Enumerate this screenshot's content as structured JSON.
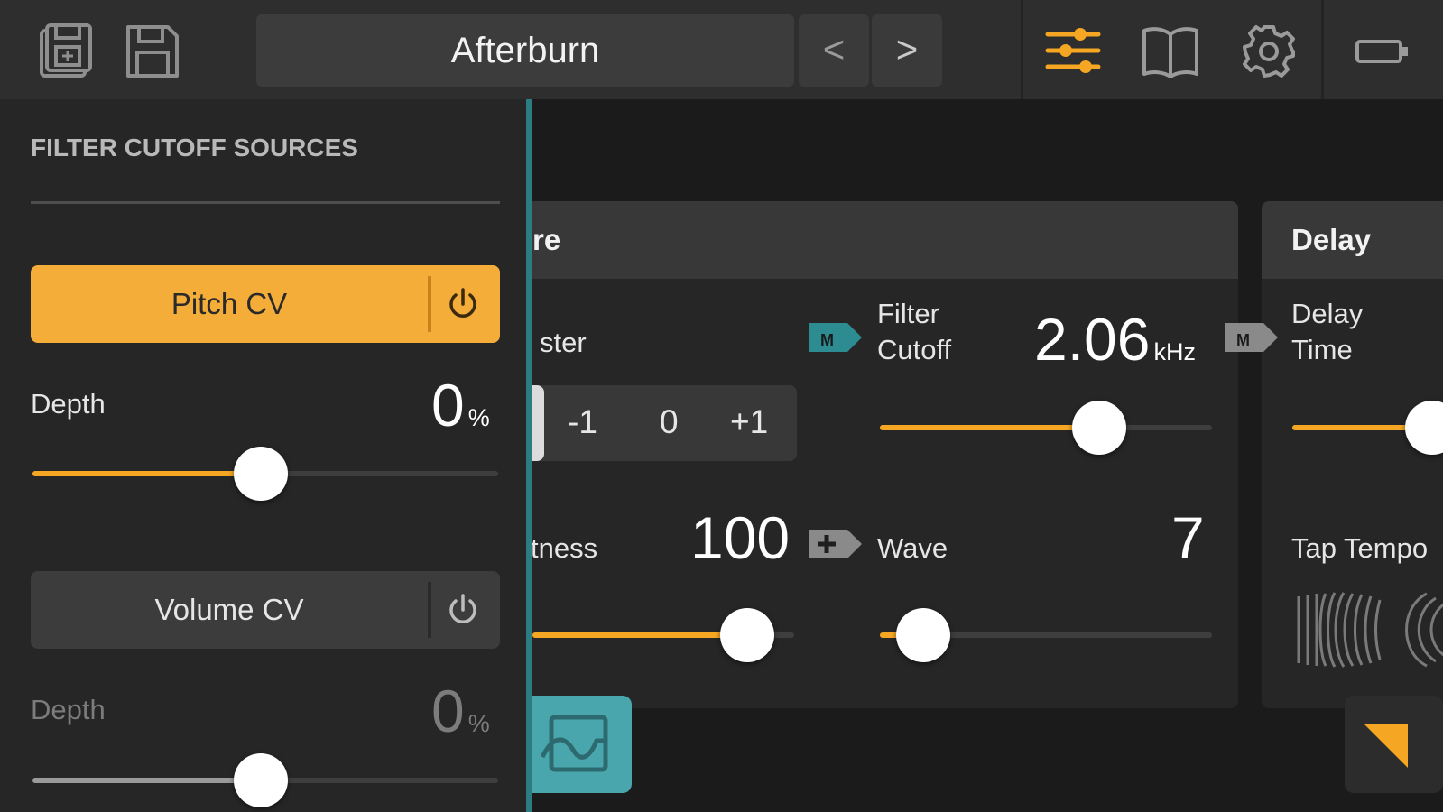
{
  "toolbar": {
    "preset_name": "Afterburn",
    "prev_label": "<",
    "next_label": ">",
    "icons": [
      "save-as-icon",
      "save-icon",
      "mixer-sliders-icon",
      "manual-book-icon",
      "gear-icon",
      "battery-icon"
    ]
  },
  "colors": {
    "accent": "#f5a623",
    "teal": "#2c7c84",
    "panel_bg": "#262626",
    "header_bg": "#2e2e2e"
  },
  "mod_panel": {
    "title": "FILTER CUTOFF SOURCES",
    "sources": [
      {
        "label": "Pitch CV",
        "active": true,
        "depth_label": "Depth",
        "depth_value": "0",
        "depth_unit": "%",
        "depth_fraction": 0.49
      },
      {
        "label": "Volume CV",
        "active": false,
        "depth_label": "Depth",
        "depth_value": "0",
        "depth_unit": "%",
        "depth_fraction": 0.49
      }
    ]
  },
  "texture_card": {
    "title_partial": "re",
    "label_partial": "ster",
    "segments": [
      "-1",
      "0",
      "+1"
    ],
    "brightness_label_partial": "tness",
    "brightness_value": "100",
    "brightness_fraction": 0.82
  },
  "filter": {
    "tag": "M",
    "cutoff_label_1": "Filter",
    "cutoff_label_2": "Cutoff",
    "cutoff_value": "2.06",
    "cutoff_unit": "kHz",
    "cutoff_fraction": 0.66,
    "wave_tag": "+",
    "wave_label": "Wave",
    "wave_value": "7",
    "wave_fraction": 0.13
  },
  "delay": {
    "title": "Delay",
    "tag": "M",
    "time_label_1": "Delay",
    "time_label_2": "Time",
    "tap_label_partial": "Tap Tempo"
  }
}
